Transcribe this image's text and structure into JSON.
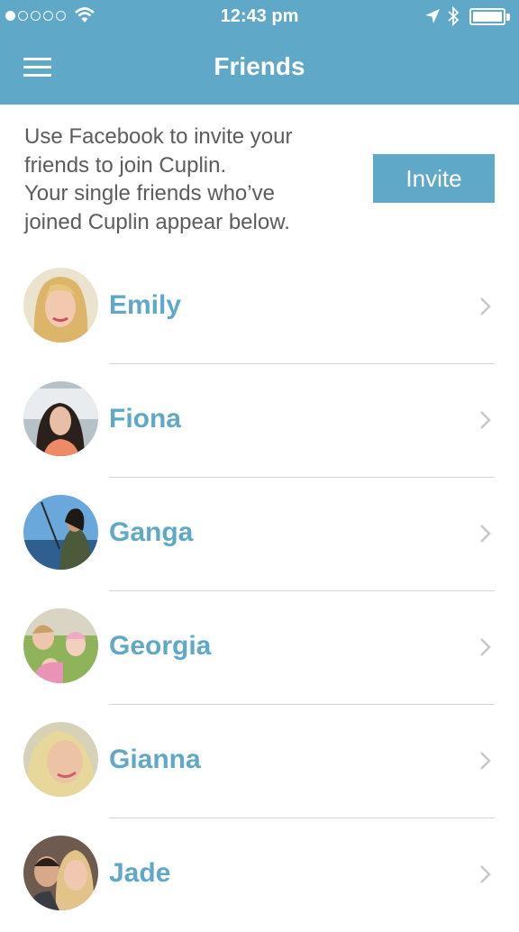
{
  "status_bar": {
    "time": "12:43 pm",
    "signal_bars_filled": 1,
    "signal_bars_total": 5,
    "battery_level": 1.0
  },
  "nav": {
    "title": "Friends",
    "menu_icon": "hamburger-menu-icon"
  },
  "intro": {
    "lines": [
      "Use Facebook to invite your",
      "friends to join Cuplin.",
      "Your single friends who’ve",
      "joined Cuplin appear below."
    ],
    "invite_label": "Invite"
  },
  "friends": [
    {
      "name": "Emily"
    },
    {
      "name": "Fiona"
    },
    {
      "name": "Ganga"
    },
    {
      "name": "Georgia"
    },
    {
      "name": "Gianna"
    },
    {
      "name": "Jade"
    }
  ],
  "colors": {
    "accent": "#5fa8c8",
    "text_gray": "#5c5c5c",
    "divider": "#d5d5d5",
    "chevron": "#c7c7cc"
  }
}
